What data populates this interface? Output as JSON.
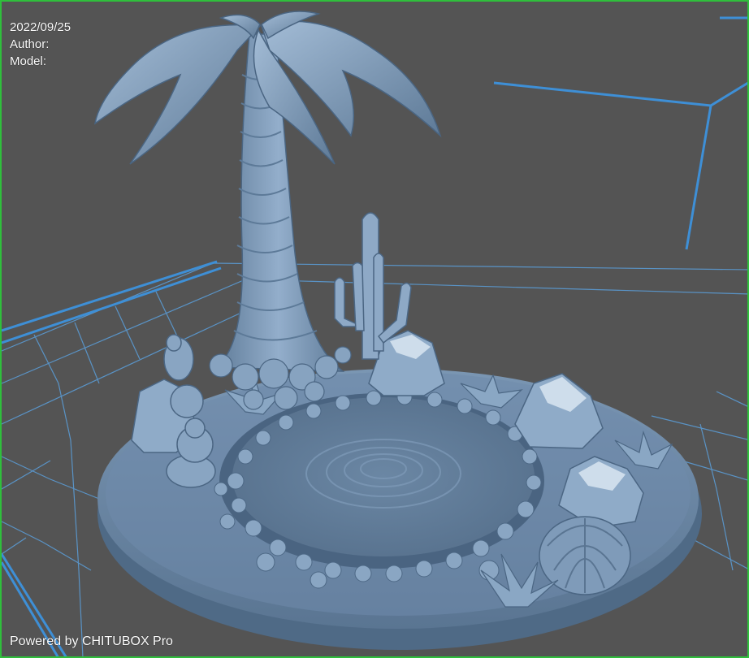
{
  "app": "CHITUBOX Pro",
  "overlay": {
    "date": "2022/09/25",
    "author_label": "Author:",
    "model_label": "Model:"
  },
  "footer": {
    "powered_by": "Powered by CHITUBOX Pro"
  },
  "colors": {
    "viewport_border": "#2fbf3c",
    "background": "#545454",
    "grid": "#5b9fdb",
    "build_volume_edge": "#3e8fd6",
    "model": "#7d9ab8"
  },
  "icons": [
    "palm-tree-model",
    "cactus-model",
    "barrel-cactus-model",
    "rock-model",
    "agave-model",
    "pond-model"
  ]
}
